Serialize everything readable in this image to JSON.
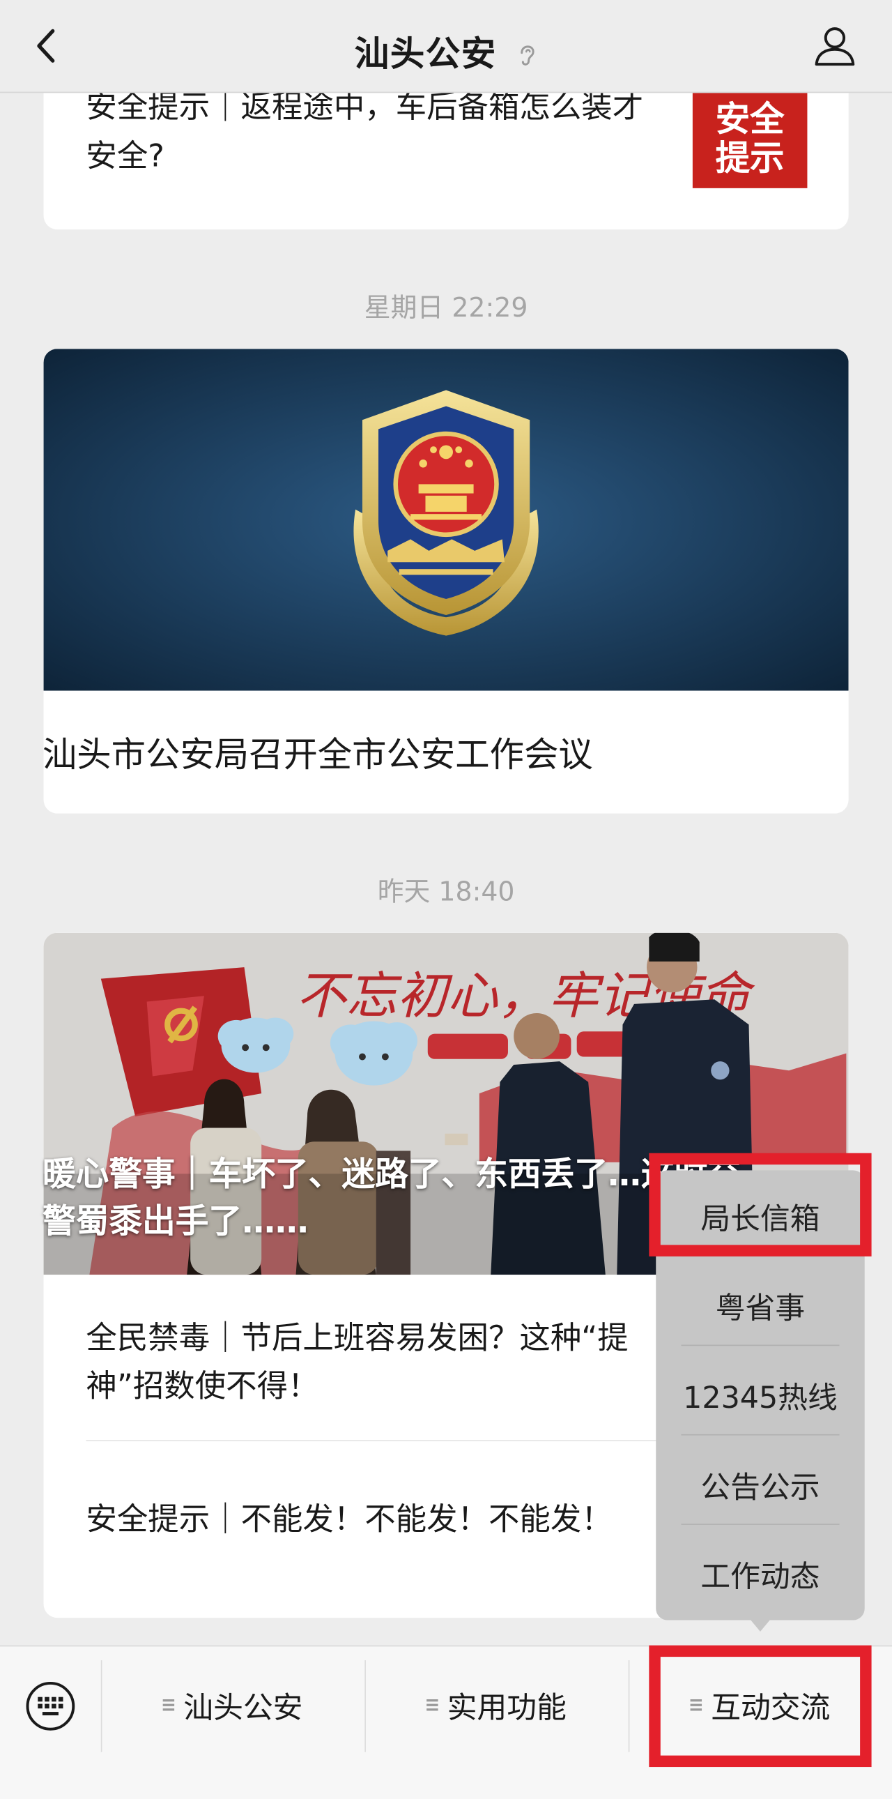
{
  "header": {
    "title": "汕头公安"
  },
  "feed": {
    "card1": {
      "title": "安全提示｜返程途中，车后备箱怎么装才安全?",
      "thumb_line1": "安全",
      "thumb_line2": "提示"
    },
    "timestamp1": "星期日 22:29",
    "card2": {
      "title": "汕头市公安局召开全市公安工作会议"
    },
    "timestamp2": "昨天 18:40",
    "card3": {
      "overlay_title": "暖心警事｜车坏了、迷路了、东西丢了…这时交警蜀黍出手了……",
      "banner_text": "不忘初心，牢记使命",
      "articles": [
        "全民禁毒｜节后上班容易发困？这种“提神”招数使不得！",
        "安全提示｜不能发！不能发！不能发！"
      ]
    }
  },
  "submenu": {
    "items": [
      "局长信箱",
      "粤省事",
      "12345热线",
      "公告公示",
      "工作动态"
    ]
  },
  "bottom_bar": {
    "items": [
      "汕头公安",
      "实用功能",
      "互动交流"
    ]
  },
  "colors": {
    "highlight": "#e4202b",
    "thumb_red": "#c8221d"
  }
}
